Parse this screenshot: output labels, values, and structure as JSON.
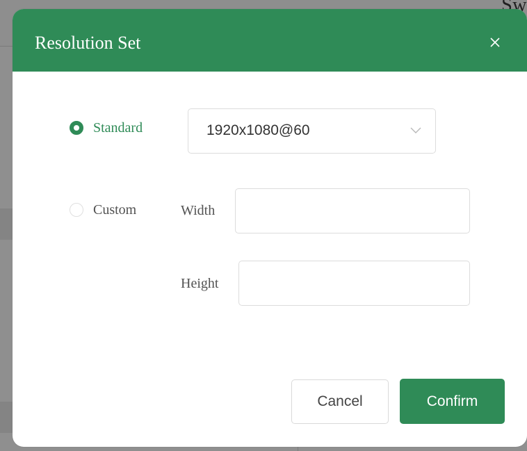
{
  "background": {
    "partial_text": "Sw"
  },
  "dialog": {
    "title": "Resolution Set",
    "close_icon": "close-icon",
    "accent_color": "#2f8b57"
  },
  "standard": {
    "label": "Standard",
    "selected": true,
    "resolution_value": "1920x1080@60"
  },
  "custom": {
    "label": "Custom",
    "selected": false,
    "width_label": "Width",
    "width_value": "",
    "height_label": "Height",
    "height_value": ""
  },
  "footer": {
    "cancel_label": "Cancel",
    "confirm_label": "Confirm"
  }
}
